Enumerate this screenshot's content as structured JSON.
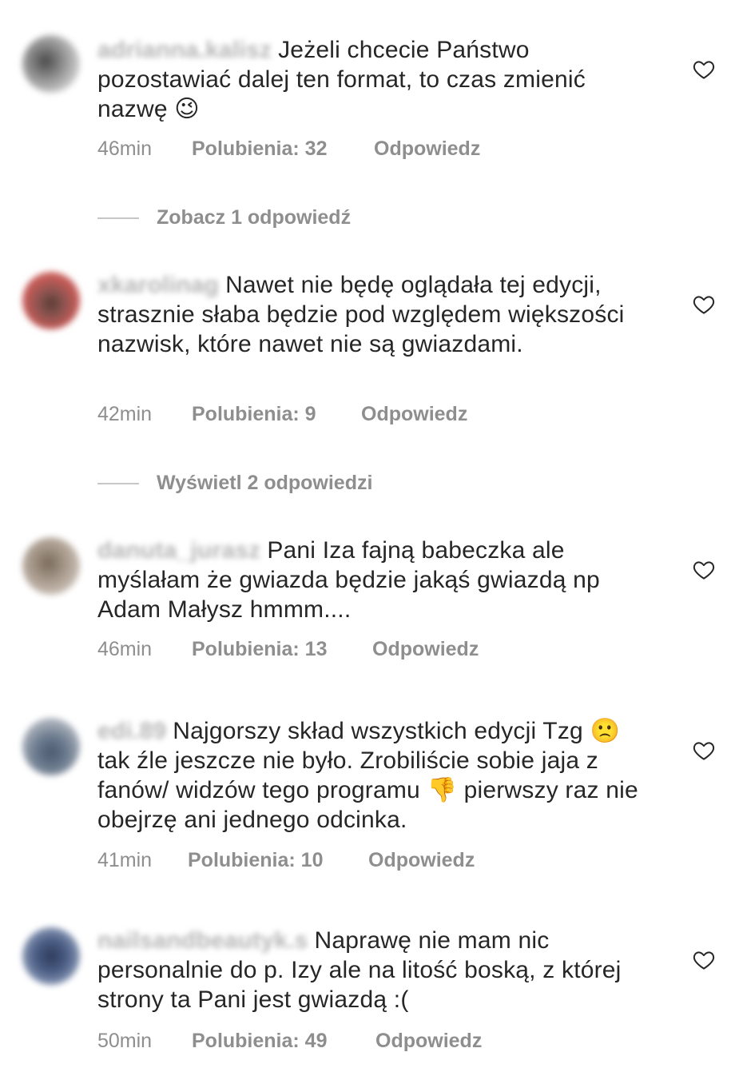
{
  "comments": [
    {
      "username": "adrianna.kalisz",
      "text": "Jeżeli chcecie Państwo pozostawiać dalej ten format, to czas zmienić nazwę",
      "emoji": "😉",
      "time": "46min",
      "likes": "Polubienia: 32",
      "reply": "Odpowiedz",
      "avatar_color": "#9a9a9a"
    },
    {
      "username": "xkarolinag",
      "text": "Nawet nie będę oglądała tej edycji, strasznie słaba będzie pod względem większości nazwisk, które nawet nie są gwiazdami.",
      "time": "42min",
      "likes": "Polubienia: 9",
      "reply": "Odpowiedz",
      "avatar_color": "#b0504a"
    },
    {
      "username": "danuta_jurasz",
      "text": "Pani Iza fajną babeczka ale myślałam że gwiazda będzie jakąś gwiazdą np Adam Małysz hmmm....",
      "time": "46min",
      "likes": "Polubienia: 13",
      "reply": "Odpowiedz",
      "avatar_color": "#9b8f80"
    },
    {
      "username": "edi.89",
      "text_part1": "Najgorszy skład wszystkich edycji Tzg",
      "emoji1": "🙁",
      "text_part2": "tak źle jeszcze nie było. Zrobiliście sobie jaja z fanów/ widzów tego programu",
      "emoji2": "👎",
      "text_part3": "pierwszy raz nie obejrzę ani jednego odcinka.",
      "time": "41min",
      "likes": "Polubienia: 10",
      "reply": "Odpowiedz",
      "avatar_color": "#7f8a9a"
    },
    {
      "username": "nailsandbeautyk.s",
      "text": "Naprawę nie mam nic personalnie do p. Izy ale na litość boską, z której strony ta Pani jest gwiazdą :(",
      "time": "50min",
      "likes": "Polubienia: 49",
      "reply": "Odpowiedz",
      "avatar_color": "#4f6285"
    }
  ],
  "view_replies": [
    "Zobacz 1 odpowiedź",
    "Wyświetl 2 odpowiedzi"
  ],
  "icons": {
    "like": "heart-outline-icon"
  }
}
